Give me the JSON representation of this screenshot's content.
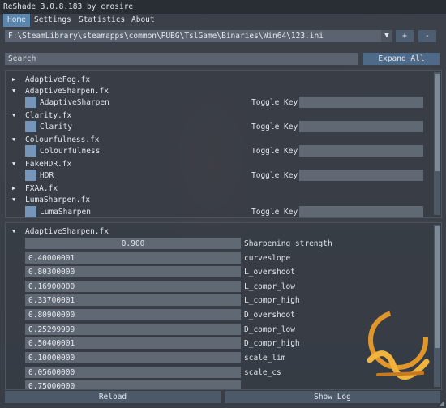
{
  "window": {
    "title": "ReShade 3.0.8.183 by crosire"
  },
  "menu": [
    "Home",
    "Settings",
    "Statistics",
    "About"
  ],
  "preset": {
    "path": "F:\\SteamLibrary\\steamapps\\common\\PUBG\\TslGame\\Binaries\\Win64\\123.ini",
    "add_label": "+",
    "remove_label": "-"
  },
  "search": {
    "placeholder": "Search",
    "expand_label": "Expand All"
  },
  "effects": [
    {
      "name": "AdaptiveFog.fx",
      "expanded": false
    },
    {
      "name": "AdaptiveSharpen.fx",
      "expanded": true,
      "technique": "AdaptiveSharpen",
      "toggle_label": "Toggle Key"
    },
    {
      "name": "Clarity.fx",
      "expanded": true,
      "technique": "Clarity",
      "toggle_label": "Toggle Key"
    },
    {
      "name": "Colourfulness.fx",
      "expanded": true,
      "technique": "Colourfulness",
      "toggle_label": "Toggle Key"
    },
    {
      "name": "FakeHDR.fx",
      "expanded": true,
      "technique": "HDR",
      "toggle_label": "Toggle Key"
    },
    {
      "name": "FXAA.fx",
      "expanded": false
    },
    {
      "name": "LumaSharpen.fx",
      "expanded": true,
      "technique": "LumaSharpen",
      "toggle_label": "Toggle Key"
    }
  ],
  "params_header": "AdaptiveSharpen.fx",
  "params": [
    {
      "value": "0.900",
      "label": "Sharpening strength"
    },
    {
      "value": "0.40000001",
      "label": "curveslope"
    },
    {
      "value": "0.80300000",
      "label": "L_overshoot"
    },
    {
      "value": "0.16900000",
      "label": "L_compr_low"
    },
    {
      "value": "0.33700001",
      "label": "L_compr_high"
    },
    {
      "value": "0.80900000",
      "label": "D_overshoot"
    },
    {
      "value": "0.25299999",
      "label": "D_compr_low"
    },
    {
      "value": "0.50400001",
      "label": "D_compr_high"
    },
    {
      "value": "0.10000000",
      "label": "scale_lim"
    },
    {
      "value": "0.05600000",
      "label": "scale_cs"
    },
    {
      "value": "0.75000000",
      "label": ""
    }
  ],
  "buttons": {
    "reload": "Reload",
    "show_log": "Show Log"
  },
  "colors": {
    "accent": "#5a86ad",
    "checkbox": "#7596b8",
    "field": "#5f6873",
    "logo": "#e0962a"
  }
}
